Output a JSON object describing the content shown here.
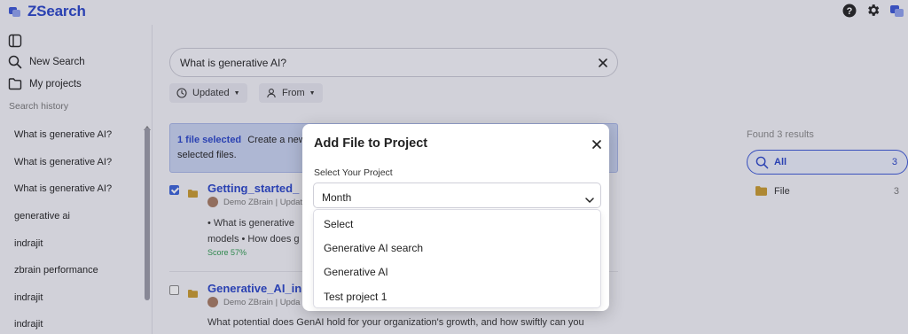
{
  "app": {
    "name": "ZSearch"
  },
  "sidebar": {
    "new_search": "New Search",
    "my_projects": "My projects",
    "history_title": "Search history",
    "history": [
      "What is generative AI?",
      "What is generative AI?",
      "What is generative AI?",
      "generative ai",
      "indrajit",
      "zbrain performance",
      "indrajit",
      "indrajit"
    ]
  },
  "search": {
    "query": "What is generative AI?"
  },
  "filters": {
    "updated": "Updated",
    "from": "From"
  },
  "banner": {
    "selected": "1 file selected",
    "line1_rest": "Create a new",
    "line2": "selected files."
  },
  "results": [
    {
      "title": "Getting_started_",
      "meta": "Demo ZBrain | Updat",
      "desc_lines": [
        "• What is generative",
        "models • How does g"
      ],
      "score": "Score 57%",
      "checked": true
    },
    {
      "title": "Generative_AI_in",
      "meta": "Demo ZBrain | Upda",
      "desc_lines": [
        "What potential does GenAI hold for your organization's growth, and how swiftly can you"
      ],
      "checked": false
    }
  ],
  "right_panel": {
    "found": "Found 3 results",
    "all_label": "All",
    "all_count": "3",
    "file_label": "File",
    "file_count": "3"
  },
  "modal": {
    "title": "Add File to Project",
    "field_label": "Select Your Project",
    "selected_value": "Month",
    "options": [
      "Select",
      "Generative AI search",
      "Generative AI",
      "Test project 1"
    ]
  },
  "colors": {
    "brand": "#2844c8",
    "accent": "#3a56d6",
    "score_green": "#2e9a4f",
    "folder_gold": "#c99a2e"
  }
}
